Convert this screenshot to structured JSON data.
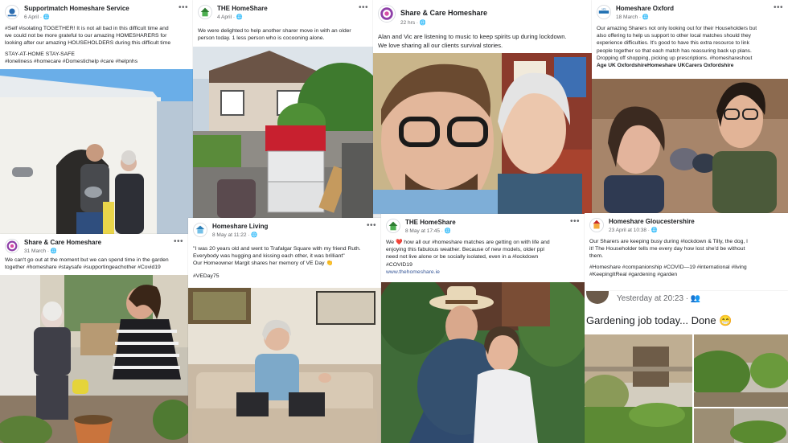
{
  "posts": [
    {
      "name": "Supportmatch Homeshare Service",
      "meta": "6 April · 🌐",
      "lines": [
        "#Self #isolating TOGETHER! It is not all bad in this difficult time and",
        "we could not be more grateful to our amazing HOMESHARERS for",
        "looking after our amazing HOUSEHOLDERS during this difficult time",
        "",
        "STAY-AT-HOME STAY-SAFE",
        "#loneliness #homecare #Domestichelp #care #helpnhs"
      ]
    },
    {
      "name": "THE HomeShare",
      "meta": "4 April · 🌐",
      "lines": [
        "We were delighted to help another sharer move in with an older",
        "person today. 1 less person who is cocooning alone."
      ]
    },
    {
      "name": "Share & Care Homeshare",
      "meta": "22 hrs · 🌐",
      "lines": [
        "Alan and Vic are listening to music to keep spirits up during lockdown.",
        "We love sharing all our clients survival stories."
      ]
    },
    {
      "name": "Homeshare Oxford",
      "meta": "18 March · 🌐",
      "lines": [
        "Our amazing Sharers not only looking out for their Householders but",
        "also offering to help us support to other local matches should they",
        "experience difficulties. It's good to have this extra resource to link",
        "people together so that each match has reassuring back up plans.",
        "Dropping off shopping, picking up prescriptions.  #homeshareshout",
        "Age UK OxfordshireHomeshare UKCarers Oxfordshire"
      ]
    },
    {
      "name": "Share & Care Homeshare",
      "meta": "31 March · 🌐",
      "lines": [
        "We can't go out at the moment but we can spend time in the garden",
        "together #homeshare #staysafe #supportingeachother #Covid19"
      ]
    },
    {
      "name": "Homeshare Living",
      "meta": "8 May at 11:22 · 🌐",
      "lines": [
        "\"I was 20 years old and went to Trafalgar Square with my friend Ruth.",
        "Everybody was hugging and kissing each other, it was brilliant\"",
        "Our Homeowner Margit shares her memory of VE Day 👏",
        "",
        "#VEDay75"
      ]
    },
    {
      "name": "THE HomeShare",
      "meta": "8 May at 17:45 · 🌐",
      "lines": [
        "We ❤️ how all our #homeshare matches are getting on with life and",
        "enjoying this fabulous weather.  Because of new models, older ppl",
        "need not live alone or be socially isolated, even in a #lockdown",
        "#COVID19"
      ],
      "link": "www.thehomeshare.ie"
    },
    {
      "name": "Homeshare Gloucestershire",
      "meta": "23 April at 10:38 · 🌐",
      "lines": [
        "Our Sharers are keeping busy during #lockdown & Tilly, the dog, l",
        "it! The Householder tells me every day how lost she'd be without",
        "them.",
        "",
        "#Homeshare #companionship #COVID—19 #international #living",
        "#KeepingItReal #gardening #garden"
      ]
    }
  ],
  "mobile_post": {
    "meta": "Yesterday at 20:23 · 👥",
    "text": "Gardening job today... Done 😁"
  },
  "colors": {
    "page_bg": "#e9ebee",
    "card_bg": "#ffffff",
    "text": "#1c1e21",
    "meta": "#65676b",
    "link": "#385898"
  },
  "icons": [
    "more-options-icon",
    "globe-icon",
    "friends-icon"
  ]
}
